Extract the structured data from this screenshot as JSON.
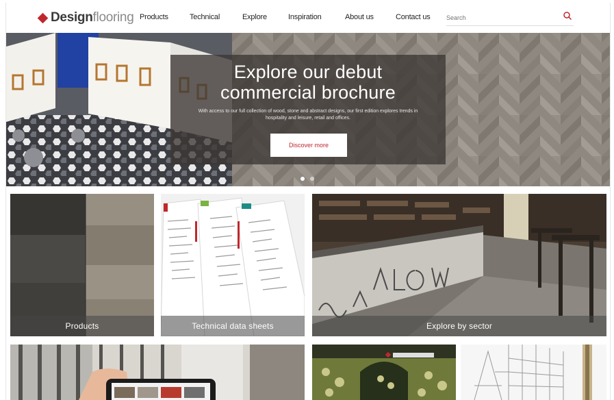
{
  "header": {
    "logo_strong": "Design",
    "logo_light": "flooring",
    "nav": [
      {
        "label": "Products"
      },
      {
        "label": "Technical"
      },
      {
        "label": "Explore"
      },
      {
        "label": "Inspiration"
      },
      {
        "label": "About us"
      },
      {
        "label": "Contact us"
      }
    ],
    "search": {
      "placeholder": "Search",
      "icon": "search-icon"
    }
  },
  "hero": {
    "title_line1": "Explore our debut",
    "title_line2": "commercial brochure",
    "subtitle": "With access to our full collection of wood, stone and abstract designs, our first edition explores trends in hospitality and leisure, retail and offices.",
    "button_label": "Discover more",
    "slides": 2,
    "active_slide": 1
  },
  "tiles": [
    {
      "caption": "Products"
    },
    {
      "caption": "Technical data sheets"
    },
    {
      "caption": "Explore by sector"
    }
  ],
  "colors": {
    "accent": "#c0272d",
    "nav_text": "#222222"
  }
}
